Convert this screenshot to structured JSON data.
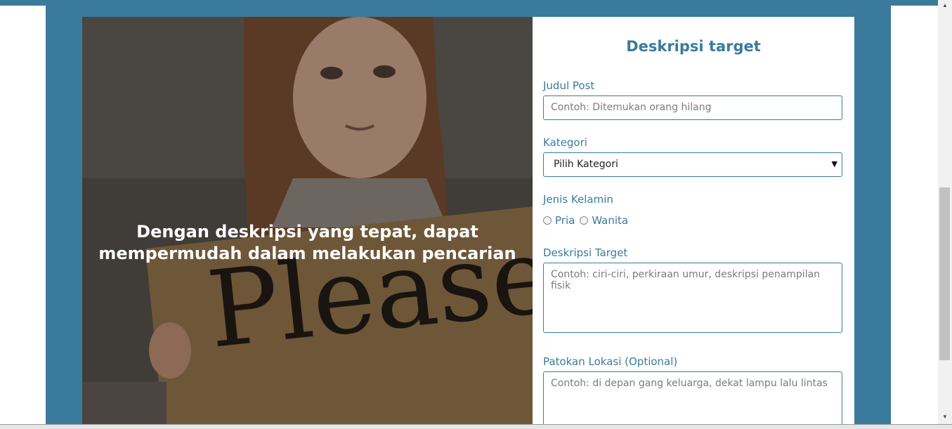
{
  "hero": {
    "caption": "Dengan deskripsi yang tepat, dapat mempermudah dalam melakukan pencarian",
    "sign_text": "Please H"
  },
  "form": {
    "title": "Deskripsi target",
    "judul_label": "Judul Post",
    "judul_placeholder": "Contoh: Ditemukan orang hilang",
    "kategori_label": "Kategori",
    "kategori_selected": "Pilih Kategori",
    "gender_label": "Jenis Kelamin",
    "gender_options": [
      "Pria",
      "Wanita"
    ],
    "deskripsi_label": "Deskripsi Target",
    "deskripsi_placeholder": "Contoh: ciri-ciri, perkiraan umur, deskripsi penampilan fisik",
    "lokasi_label": "Patokan Lokasi (Optional)",
    "lokasi_placeholder": "Contoh: di depan gang keluarga, dekat lampu lalu lintas"
  },
  "colors": {
    "brand": "#3a7b9c",
    "background": "#ffffff"
  },
  "icons": {
    "select_arrow": "caret-down-icon",
    "scroll_up": "scroll-up-arrow-icon",
    "scroll_down": "scroll-down-arrow-icon"
  }
}
